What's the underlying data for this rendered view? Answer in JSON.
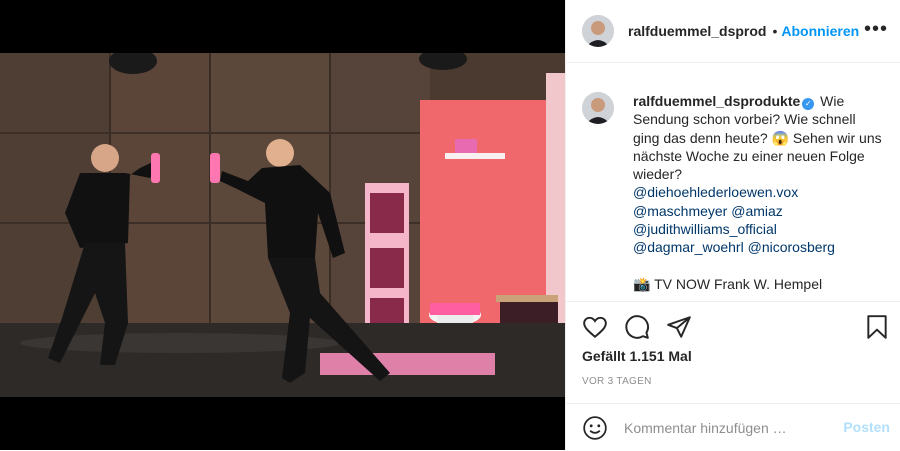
{
  "post": {
    "username": "ralfduemmel_dsprod",
    "separator": "•",
    "follow_label": "Abonnieren",
    "more_label": "•••"
  },
  "caption": {
    "username": "ralfduemmel_dsprodukte",
    "verified_mark": "✓",
    "text": "Wie Sendung schon vorbei? Wie schnell ging das denn heute? 😱 Sehen wir uns nächste Woche zu einer neuen Folge wieder?",
    "mentions": [
      "@diehoehlederloewen.vox",
      "@maschmeyer",
      "@amiaz",
      "@judithwilliams_official",
      "@dagmar_woehrl",
      "@nicorosberg"
    ],
    "credit": "📸 TV NOW Frank W. Hempel"
  },
  "stats": {
    "likes": "Gefällt 1.151 Mal",
    "time": "VOR 3 TAGEN"
  },
  "comment": {
    "placeholder": "Kommentar hinzufügen …",
    "post_label": "Posten"
  },
  "icons": [
    "heart-icon",
    "comment-icon",
    "share-icon",
    "bookmark-icon",
    "emoji-icon",
    "more-icon"
  ],
  "colors": {
    "accent": "#0095f6",
    "mention": "#00376b",
    "muted": "#8e8e8e",
    "post_disabled": "#b2dffc",
    "verified": "#3897f0"
  }
}
